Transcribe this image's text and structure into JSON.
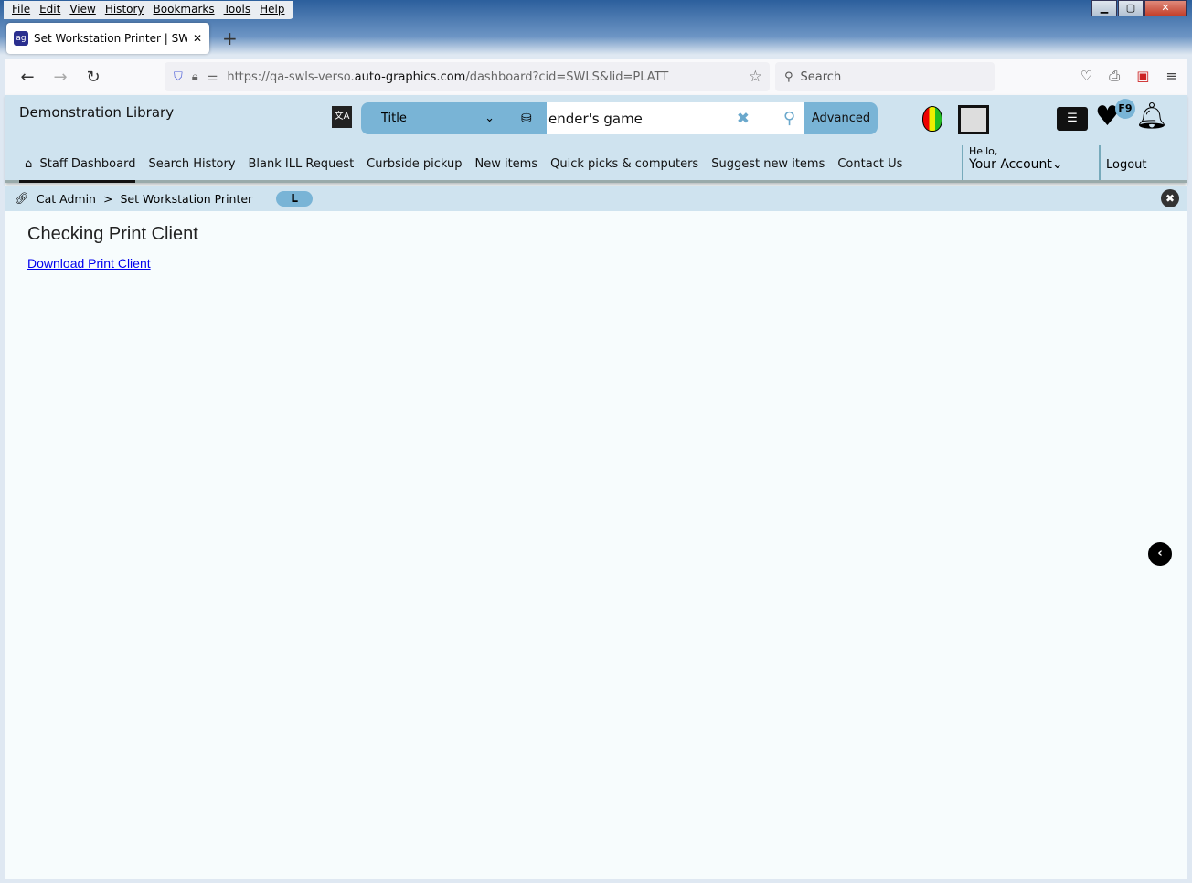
{
  "browser": {
    "menu": [
      "File",
      "Edit",
      "View",
      "History",
      "Bookmarks",
      "Tools",
      "Help"
    ],
    "tab_title": "Set Workstation Printer | SWLS |",
    "url_prefix": "https://qa-swls-verso.",
    "url_domain": "auto-graphics.com",
    "url_path": "/dashboard?cid=SWLS&lid=PLATT",
    "search_placeholder": "Search"
  },
  "site": {
    "library_name": "Demonstration Library",
    "search": {
      "type": "Title",
      "query": "ender's game",
      "advanced": "Advanced"
    },
    "badge": "F9",
    "nav": [
      "Staff Dashboard",
      "Search History",
      "Blank ILL Request",
      "Curbside pickup",
      "New items",
      "Quick picks & computers",
      "Suggest new items",
      "Contact Us"
    ],
    "account": {
      "hello": "Hello,",
      "label": "Your Account"
    },
    "logout": "Logout",
    "breadcrumb": {
      "parent": "Cat Admin",
      "sep": ">",
      "current": "Set Workstation Printer",
      "pill": "L"
    }
  },
  "main": {
    "heading": "Checking Print Client",
    "link": "Download Print Client"
  }
}
